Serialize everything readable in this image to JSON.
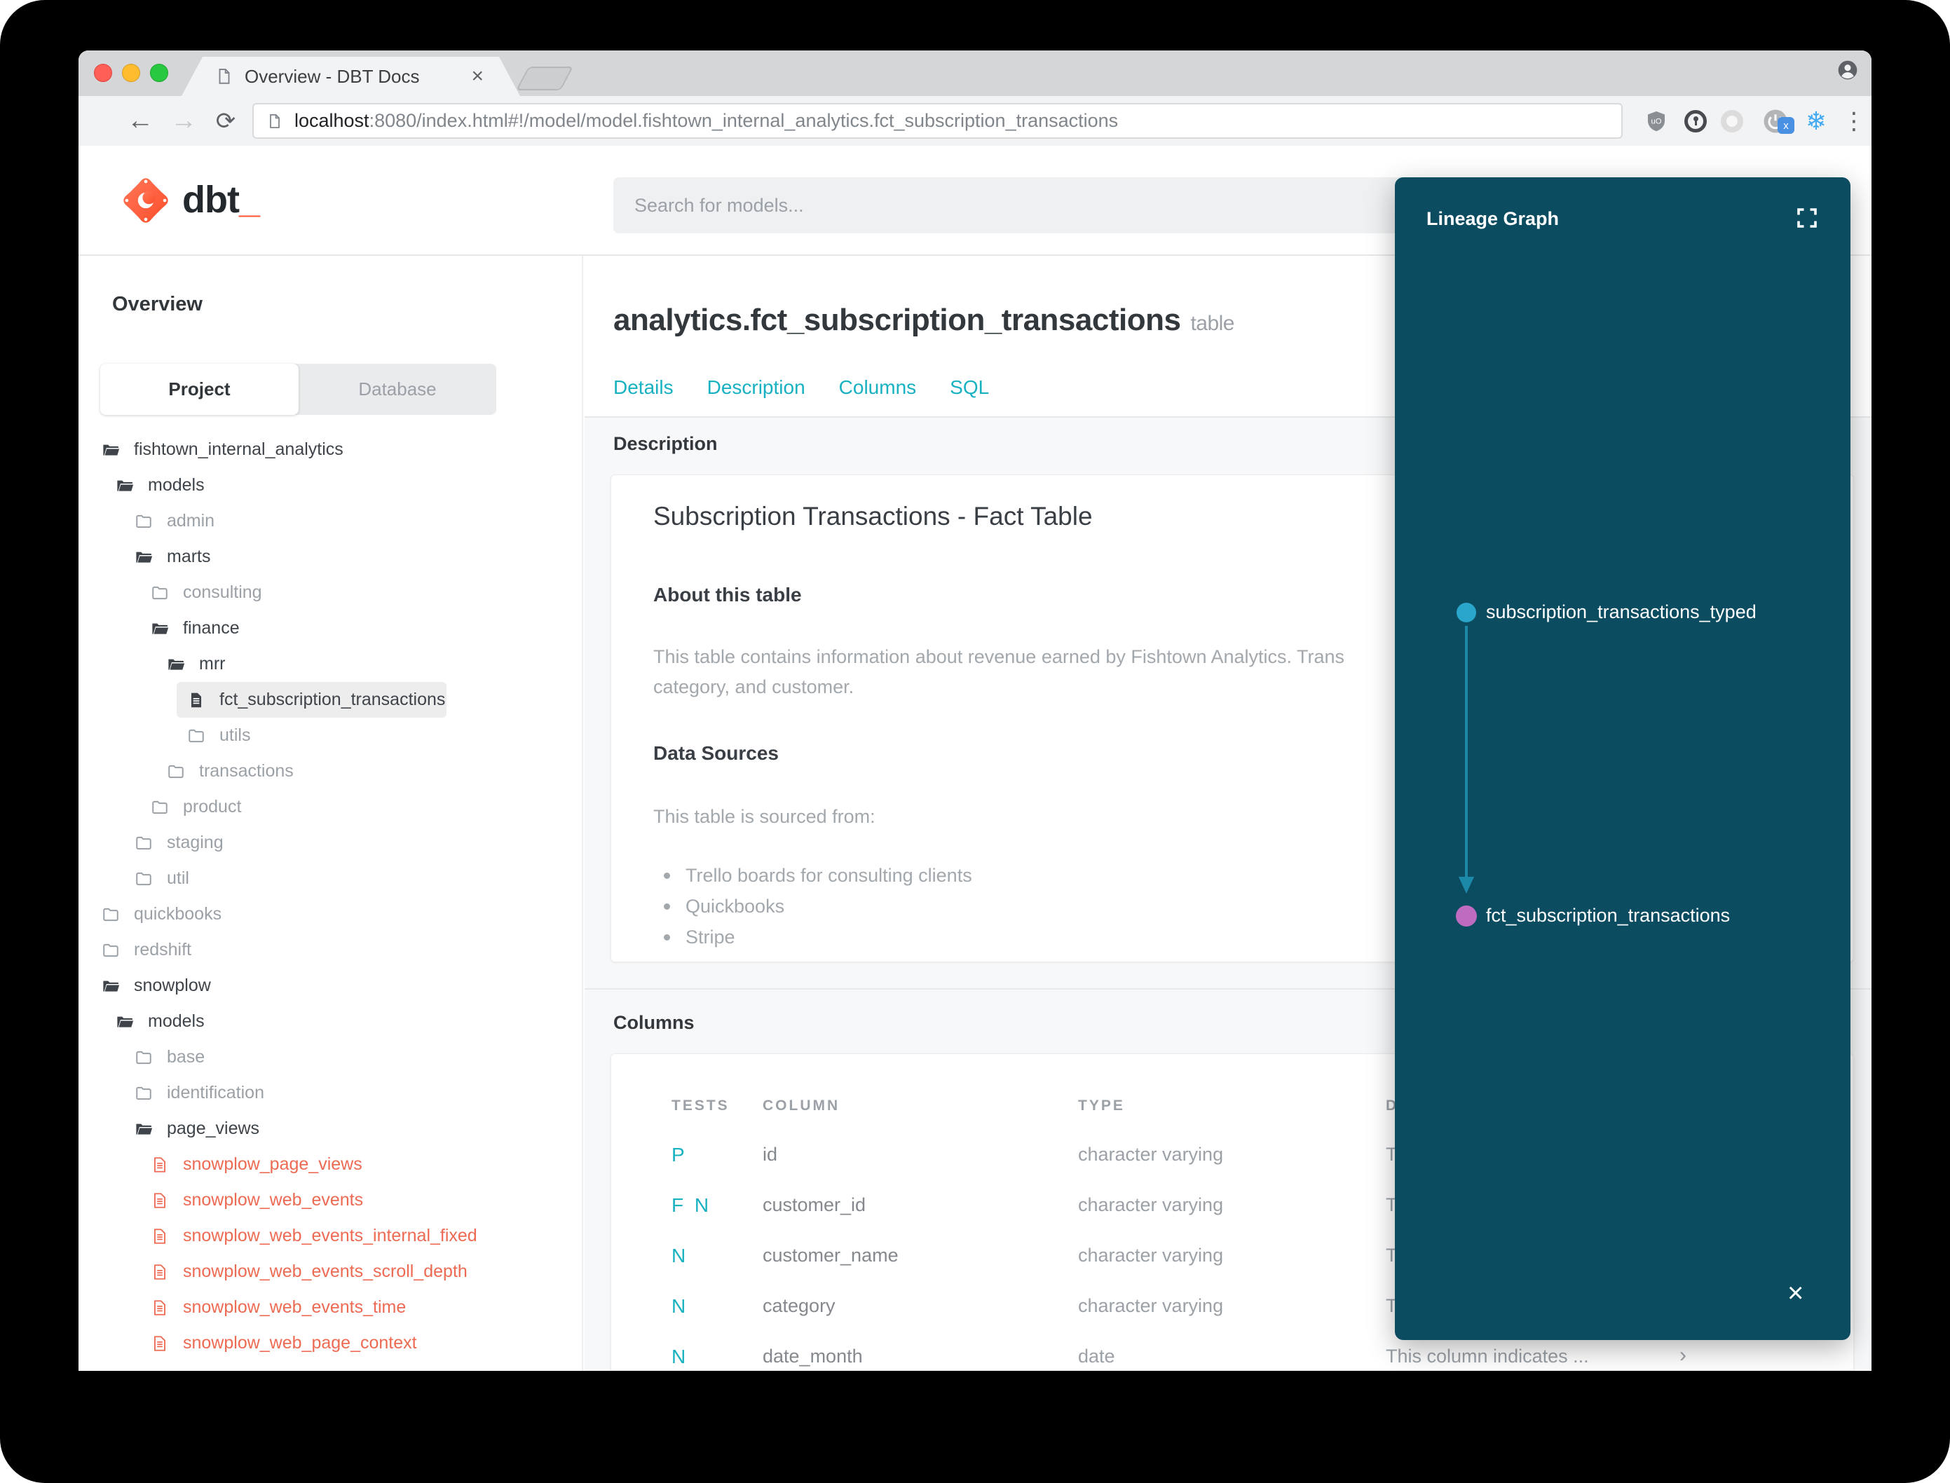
{
  "browser": {
    "tab_title": "Overview - DBT Docs",
    "close_tab_glyph": "×",
    "back_glyph": "←",
    "forward_glyph": "→",
    "reload_glyph": "⟳",
    "url_host": "localhost",
    "url_rest": ":8080/index.html#!/model/model.fishtown_internal_analytics.fct_subscription_transactions",
    "menu_glyph": "⋮",
    "snowflake_glyph": "❄",
    "extension_badge": "x",
    "ublock_text": "uO"
  },
  "header": {
    "logo_text": "dbt",
    "logo_underscore": "_",
    "search_placeholder": "Search for models..."
  },
  "sidebar": {
    "overview_label": "Overview",
    "source_tabs": {
      "project": "Project",
      "database": "Database"
    },
    "tree": [
      {
        "label": "fishtown_internal_analytics",
        "state": "open"
      },
      {
        "label": "models",
        "state": "open"
      },
      {
        "label": "admin",
        "state": "closed"
      },
      {
        "label": "marts",
        "state": "open"
      },
      {
        "label": "consulting",
        "state": "closed"
      },
      {
        "label": "finance",
        "state": "open"
      },
      {
        "label": "mrr",
        "state": "open"
      },
      {
        "label": "fct_subscription_transactions",
        "state": "file-selected"
      },
      {
        "label": "utils",
        "state": "closed"
      },
      {
        "label": "transactions",
        "state": "closed"
      },
      {
        "label": "product",
        "state": "closed"
      },
      {
        "label": "staging",
        "state": "closed"
      },
      {
        "label": "util",
        "state": "closed"
      },
      {
        "label": "quickbooks",
        "state": "closed"
      },
      {
        "label": "redshift",
        "state": "closed"
      },
      {
        "label": "snowplow",
        "state": "open"
      },
      {
        "label": "models",
        "state": "open"
      },
      {
        "label": "base",
        "state": "closed"
      },
      {
        "label": "identification",
        "state": "closed"
      },
      {
        "label": "page_views",
        "state": "open"
      },
      {
        "label": "snowplow_page_views",
        "state": "file-accent"
      },
      {
        "label": "snowplow_web_events",
        "state": "file-accent"
      },
      {
        "label": "snowplow_web_events_internal_fixed",
        "state": "file-accent"
      },
      {
        "label": "snowplow_web_events_scroll_depth",
        "state": "file-accent"
      },
      {
        "label": "snowplow_web_events_time",
        "state": "file-accent"
      },
      {
        "label": "snowplow_web_page_context",
        "state": "file-accent"
      }
    ]
  },
  "main": {
    "title": "analytics.fct_subscription_transactions",
    "title_suffix": "table",
    "tabs": [
      "Details",
      "Description",
      "Columns",
      "SQL"
    ],
    "description_section": {
      "label": "Description",
      "card_title": "Subscription Transactions - Fact Table",
      "about_heading": "About this table",
      "about_line1": "This table contains information about revenue earned by Fishtown Analytics. Trans",
      "about_line2": "category, and customer.",
      "sources_heading": "Data Sources",
      "sources_intro": "This table is sourced from:",
      "sources": [
        "Trello boards for consulting clients",
        "Quickbooks",
        "Stripe"
      ]
    },
    "columns_section": {
      "label": "Columns",
      "headers": {
        "tests": "TESTS",
        "column": "COLUMN",
        "type": "TYPE",
        "description": "DESCRIPTION"
      },
      "rows": [
        {
          "tests": "P",
          "column": "id",
          "type": "character varying",
          "description": "T",
          "chevron": ""
        },
        {
          "tests": "F N",
          "column": "customer_id",
          "type": "character varying",
          "description": "T",
          "chevron": ""
        },
        {
          "tests": "N",
          "column": "customer_name",
          "type": "character varying",
          "description": "T",
          "chevron": ""
        },
        {
          "tests": "N",
          "column": "category",
          "type": "character varying",
          "description": "T",
          "chevron": ""
        },
        {
          "tests": "N",
          "column": "date_month",
          "type": "date",
          "description": "This column indicates ...",
          "chevron": "›"
        }
      ]
    }
  },
  "lineage": {
    "title": "Lineage Graph",
    "close_glyph": "×",
    "panel_color": "#0b4c61",
    "arrow_color": "#1d89a8",
    "nodes": [
      {
        "label": "subscription_transactions_typed",
        "color": "#2aa6cc"
      },
      {
        "label": "fct_subscription_transactions",
        "color": "#bf6cc0"
      }
    ]
  },
  "colors": {
    "accent_teal": "#18b1c1",
    "file_accent": "#ed6a53"
  }
}
